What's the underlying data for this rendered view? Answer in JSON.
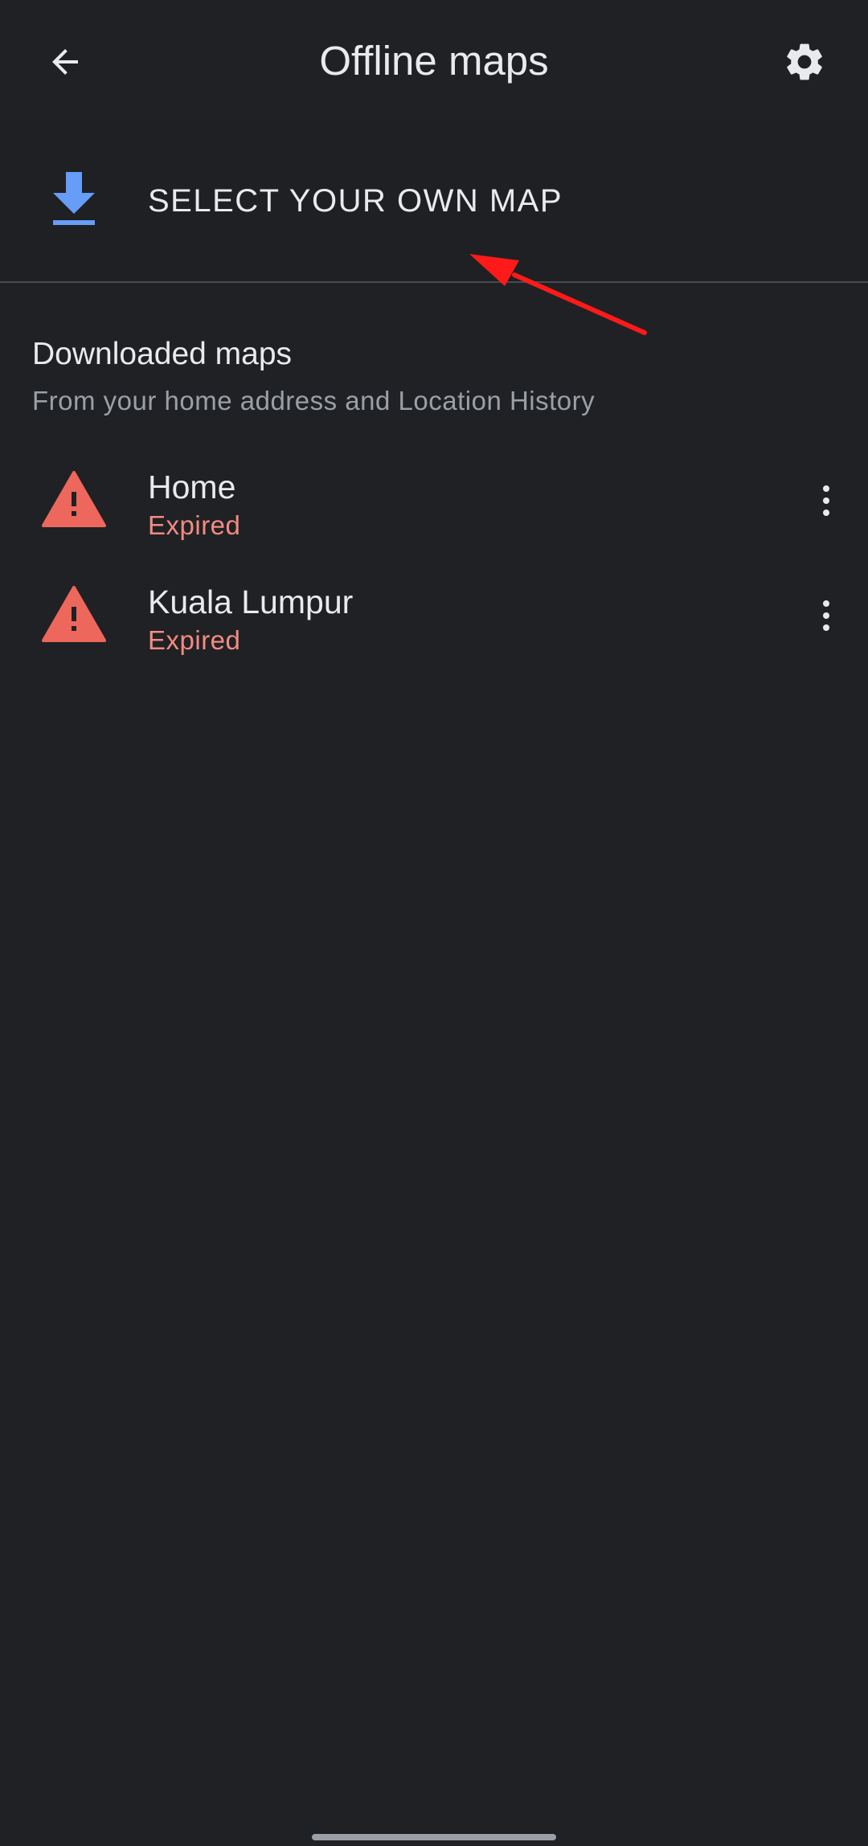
{
  "app_bar": {
    "title": "Offline maps",
    "back_icon": "arrow-left-icon",
    "settings_icon": "gear-icon"
  },
  "select_map": {
    "label": "SELECT YOUR OWN MAP",
    "icon": "download-icon",
    "icon_color": "#669df6"
  },
  "downloaded": {
    "title": "Downloaded maps",
    "subtitle": "From your home address and Location History",
    "items": [
      {
        "name": "Home",
        "status": "Expired",
        "icon": "warning-icon"
      },
      {
        "name": "Kuala Lumpur",
        "status": "Expired",
        "icon": "warning-icon"
      }
    ]
  },
  "colors": {
    "background": "#202124",
    "text_primary": "#e8eaed",
    "text_secondary": "#9aa0a6",
    "expired": "#f28b82",
    "warning_icon": "#ee675c",
    "annotation_arrow": "#ff1a1a"
  }
}
